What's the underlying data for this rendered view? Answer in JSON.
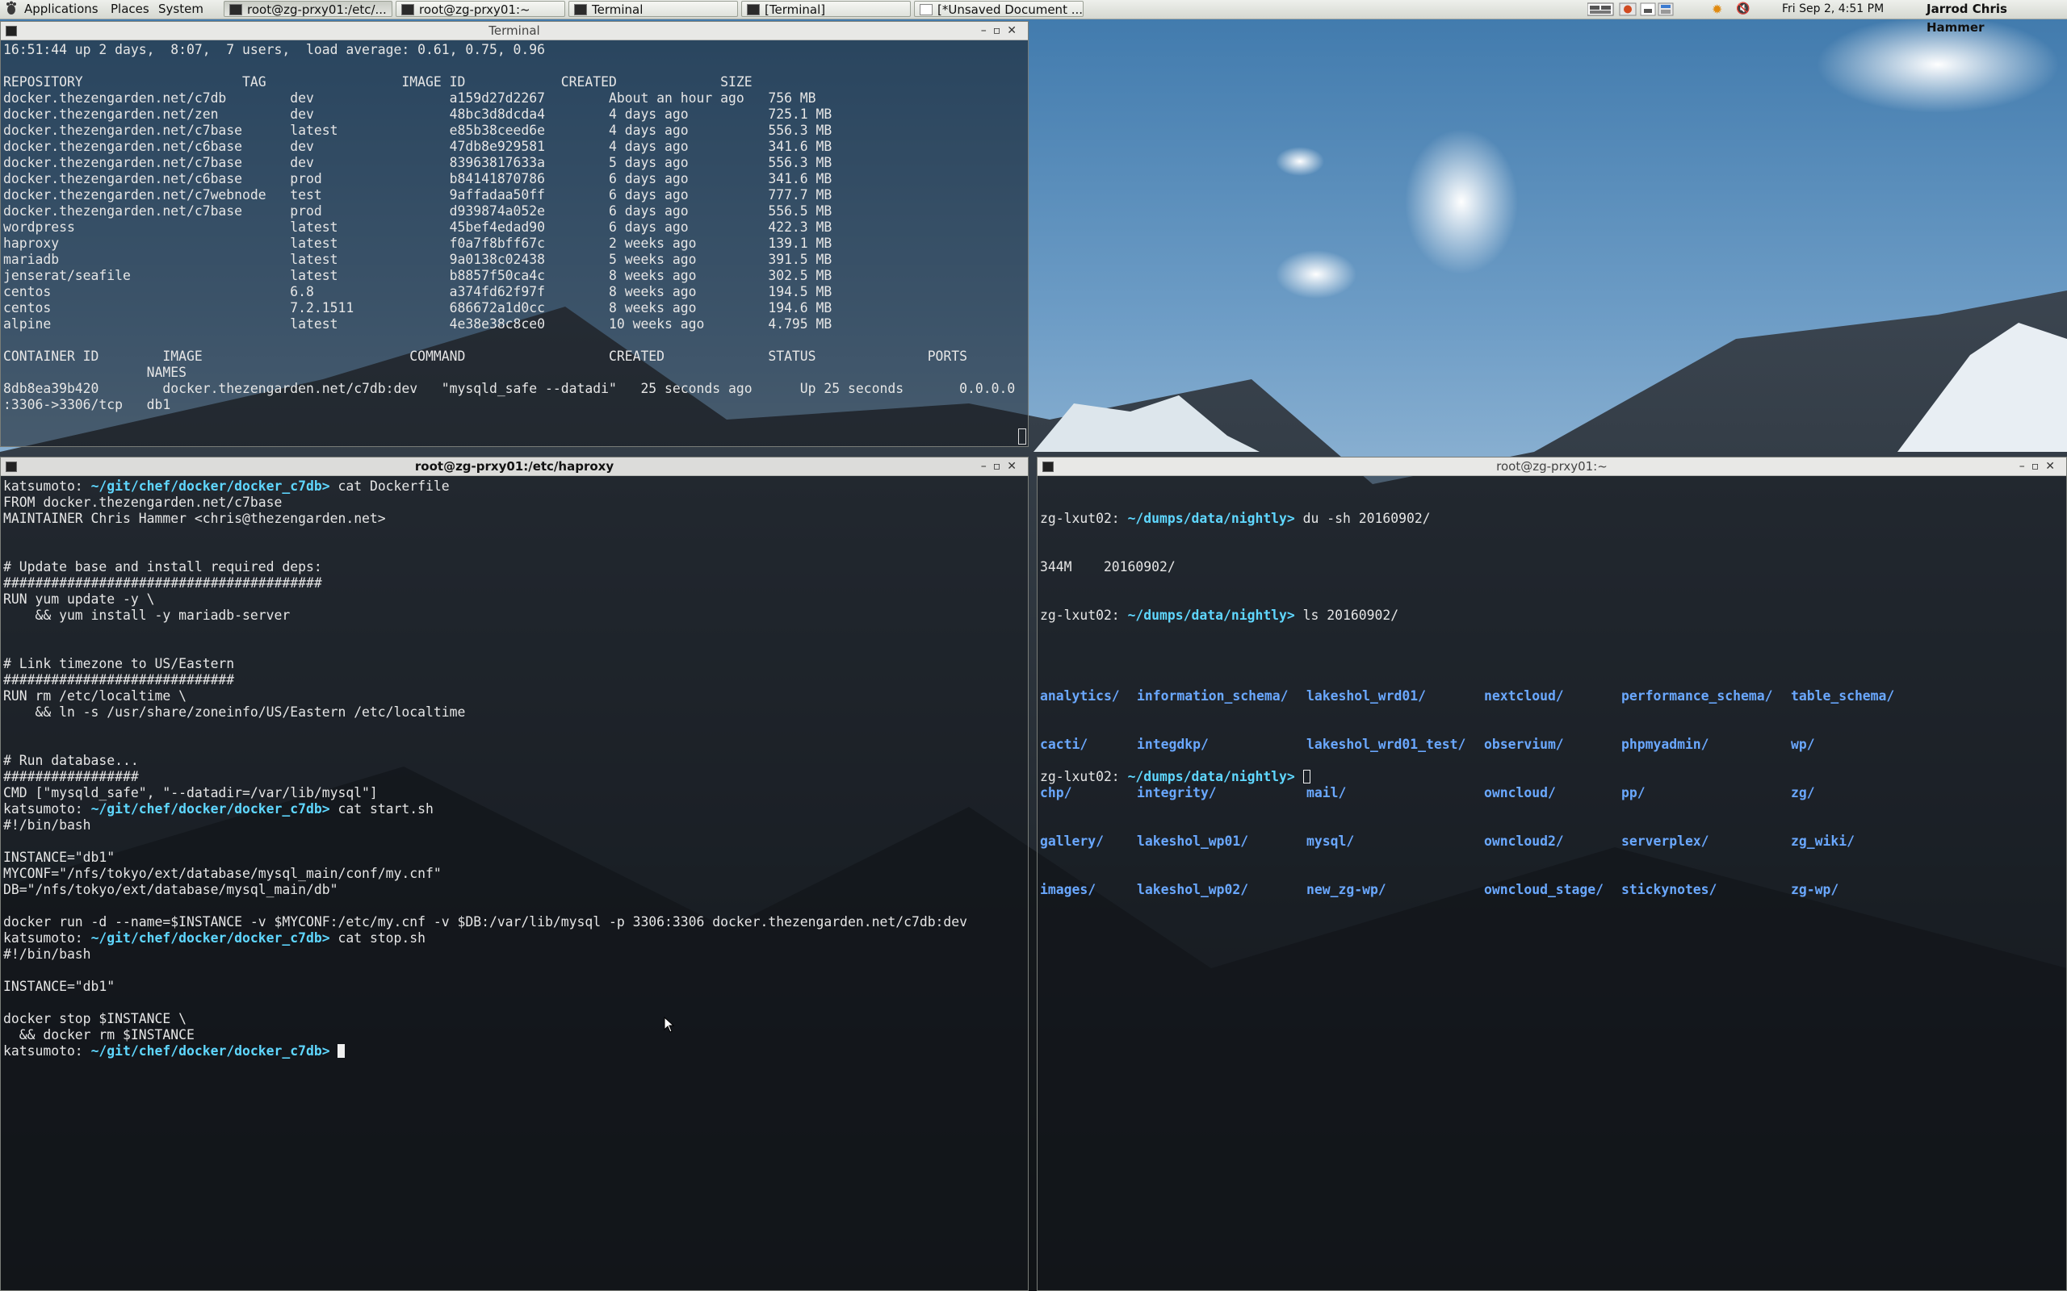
{
  "panel": {
    "menus": [
      "Applications",
      "Places",
      "System"
    ],
    "tasks": [
      {
        "label": "root@zg-prxy01:/etc/...",
        "active": true
      },
      {
        "label": "root@zg-prxy01:~",
        "active": false
      },
      {
        "label": "Terminal",
        "active": false
      },
      {
        "label": "[Terminal]",
        "active": false
      },
      {
        "label": "[*Unsaved Document ...",
        "active": false
      }
    ],
    "clock": "Fri Sep  2,  4:51 PM",
    "user": "Jarrod Chris Hammer"
  },
  "win_top": {
    "title": "Terminal",
    "lines": [
      "16:51:44 up 2 days,  8:07,  7 users,  load average: 0.61, 0.75, 0.96",
      "",
      "REPOSITORY                    TAG                 IMAGE ID            CREATED             SIZE",
      "docker.thezengarden.net/c7db        dev                 a159d27d2267        About an hour ago   756 MB",
      "docker.thezengarden.net/zen         dev                 48bc3d8dcda4        4 days ago          725.1 MB",
      "docker.thezengarden.net/c7base      latest              e85b38ceed6e        4 days ago          556.3 MB",
      "docker.thezengarden.net/c6base      dev                 47db8e929581        4 days ago          341.6 MB",
      "docker.thezengarden.net/c7base      dev                 83963817633a        5 days ago          556.3 MB",
      "docker.thezengarden.net/c6base      prod                b84141870786        6 days ago          341.6 MB",
      "docker.thezengarden.net/c7webnode   test                9affadaa50ff        6 days ago          777.7 MB",
      "docker.thezengarden.net/c7base      prod                d939874a052e        6 days ago          556.5 MB",
      "wordpress                           latest              45bef4edad90        6 days ago          422.3 MB",
      "haproxy                             latest              f0a7f8bff67c        2 weeks ago         139.1 MB",
      "mariadb                             latest              9a0138c02438        5 weeks ago         391.5 MB",
      "jenserat/seafile                    latest              b8857f50ca4c        8 weeks ago         302.5 MB",
      "centos                              6.8                 a374fd62f97f        8 weeks ago         194.5 MB",
      "centos                              7.2.1511            686672a1d0cc        8 weeks ago         194.6 MB",
      "alpine                              latest              4e38e38c8ce0        10 weeks ago        4.795 MB",
      "",
      "CONTAINER ID        IMAGE                          COMMAND                  CREATED             STATUS              PORTS",
      "                  NAMES",
      "8db8ea39b420        docker.thezengarden.net/c7db:dev   \"mysqld_safe --datadi\"   25 seconds ago      Up 25 seconds       0.0.0.0",
      ":3306->3306/tcp   db1"
    ]
  },
  "win_left": {
    "title": "root@zg-prxy01:/etc/haproxy",
    "prompt_user": "katsumoto:",
    "prompt_path": "~/git/chef/docker/docker_c7db>",
    "lines": [
      {
        "p": true,
        "cmd": " cat Dockerfile"
      },
      {
        "t": "FROM docker.thezengarden.net/c7base"
      },
      {
        "t": "MAINTAINER Chris Hammer <chris@thezengarden.net>"
      },
      {
        "t": ""
      },
      {
        "t": ""
      },
      {
        "t": "# Update base and install required deps:"
      },
      {
        "t": "########################################"
      },
      {
        "t": "RUN yum update -y \\"
      },
      {
        "t": "    && yum install -y mariadb-server"
      },
      {
        "t": ""
      },
      {
        "t": ""
      },
      {
        "t": "# Link timezone to US/Eastern"
      },
      {
        "t": "#############################"
      },
      {
        "t": "RUN rm /etc/localtime \\"
      },
      {
        "t": "    && ln -s /usr/share/zoneinfo/US/Eastern /etc/localtime"
      },
      {
        "t": ""
      },
      {
        "t": ""
      },
      {
        "t": "# Run database..."
      },
      {
        "t": "#################"
      },
      {
        "t": "CMD [\"mysqld_safe\", \"--datadir=/var/lib/mysql\"]"
      },
      {
        "p": true,
        "cmd": " cat start.sh"
      },
      {
        "t": "#!/bin/bash"
      },
      {
        "t": ""
      },
      {
        "t": "INSTANCE=\"db1\""
      },
      {
        "t": "MYCONF=\"/nfs/tokyo/ext/database/mysql_main/conf/my.cnf\""
      },
      {
        "t": "DB=\"/nfs/tokyo/ext/database/mysql_main/db\""
      },
      {
        "t": ""
      },
      {
        "t": "docker run -d --name=$INSTANCE -v $MYCONF:/etc/my.cnf -v $DB:/var/lib/mysql -p 3306:3306 docker.thezengarden.net/c7db:dev"
      },
      {
        "p": true,
        "cmd": " cat stop.sh"
      },
      {
        "t": "#!/bin/bash"
      },
      {
        "t": ""
      },
      {
        "t": "INSTANCE=\"db1\""
      },
      {
        "t": ""
      },
      {
        "t": "docker stop $INSTANCE \\"
      },
      {
        "t": "  && docker rm $INSTANCE"
      },
      {
        "p": true,
        "cmd": " ",
        "cursor": true
      }
    ]
  },
  "win_right": {
    "title": "root@zg-prxy01:~",
    "prompt_host": "zg-lxut02:",
    "prompt_path": "~/dumps/data/nightly>",
    "cmd1": " du -sh 20160902/",
    "out1": "344M    20160902/",
    "cmd2": " ls 20160902/",
    "dirs": [
      [
        "analytics/",
        "cacti/",
        "chp/",
        "gallery/",
        "images/"
      ],
      [
        "information_schema/",
        "integdkp/",
        "integrity/",
        "lakeshol_wp01/",
        "lakeshol_wp02/"
      ],
      [
        "lakeshol_wrd01/",
        "lakeshol_wrd01_test/",
        "mail/",
        "mysql/",
        "new_zg-wp/"
      ],
      [
        "nextcloud/",
        "observium/",
        "owncloud/",
        "owncloud2/",
        "owncloud_stage/"
      ],
      [
        "performance_schema/",
        "phpmyadmin/",
        "pp/",
        "serverplex/",
        "stickynotes/"
      ],
      [
        "table_schema/",
        "wp/",
        "zg/",
        "zg_wiki/",
        "zg-wp/"
      ]
    ]
  }
}
